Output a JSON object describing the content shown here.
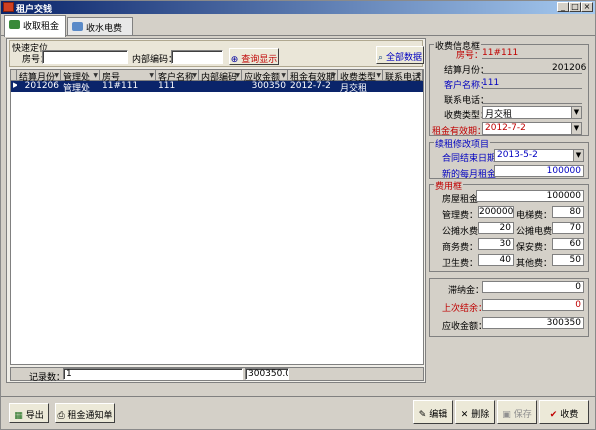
{
  "window": {
    "title": "租户交钱"
  },
  "tabs": [
    {
      "label": "收取租金"
    },
    {
      "label": "收水电费"
    }
  ],
  "quick_search": {
    "title": "快速定位",
    "room_label": "房号：",
    "room_value": "",
    "code_label": "内部编码：",
    "code_value": "",
    "query_button": "查询显示",
    "all_button": "全部数据"
  },
  "grid": {
    "columns": [
      "结算月份",
      "管理处",
      "房号",
      "客户名称",
      "内部编码",
      "应收金额",
      "租金有效期",
      "收费类型",
      "联系电话"
    ],
    "rows": [
      [
        "201206",
        "管理处",
        "11#111",
        "111",
        "",
        "300350",
        "2012-7-2",
        "月交租",
        ""
      ]
    ],
    "footer": {
      "count_label": "记录数：",
      "count": "1",
      "total": "300350.00"
    }
  },
  "info": {
    "title": "收费信息框",
    "room_label": "房号：",
    "room_value": "11#111",
    "month_label": "结算月份：",
    "month_value": "201206",
    "customer_label": "客户名称：",
    "customer_value": "111",
    "phone_label": "联系电话：",
    "phone_value": "",
    "type_label": "收费类型：",
    "type_value": "月交租",
    "validity_label": "租金有效期：",
    "validity_value": "2012-7-2"
  },
  "renew": {
    "title": "续租修改项目",
    "contract_label": "合同结束日期：",
    "contract_value": "2013-5-2",
    "monthly_label": "新的每月租金：",
    "monthly_value": "100000"
  },
  "fees": {
    "title": "费用框",
    "rent_label": "房屋租金：",
    "rent_value": "100000",
    "items": [
      {
        "l1": "管理费：",
        "v1": "200000",
        "l2": "电梯费：",
        "v2": "80"
      },
      {
        "l1": "公摊水费：",
        "v1": "20",
        "l2": "公摊电费：",
        "v2": "70"
      },
      {
        "l1": "商务费：",
        "v1": "30",
        "l2": "保安费：",
        "v2": "60"
      },
      {
        "l1": "卫生费：",
        "v1": "40",
        "l2": "其他费：",
        "v2": "50"
      }
    ]
  },
  "summary": {
    "late_label": "滞纳金：",
    "late_value": "0",
    "balance_label": "上次结余：",
    "balance_value": "0",
    "due_label": "应收金额：",
    "due_value": "300350"
  },
  "bottom": {
    "export": "导出",
    "notice": "租金通知单",
    "edit": "编辑",
    "delete": "删除",
    "save": "保存",
    "collect": "收费"
  },
  "colors": {
    "title_bar": "#0a246a",
    "selected_row": "#0a246a",
    "label_red": "#c00000",
    "label_blue": "#0000c0"
  }
}
